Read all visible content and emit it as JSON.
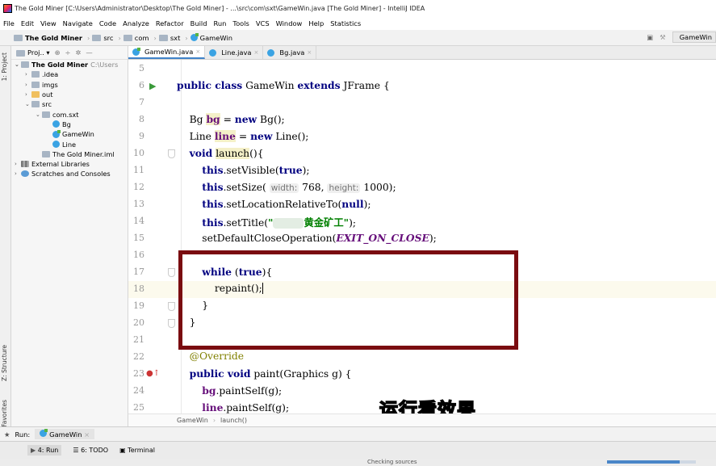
{
  "window": {
    "title": "The Gold Miner [C:\\Users\\Administrator\\Desktop\\The Gold Miner] - ...\\src\\com\\sxt\\GameWin.java [The Gold Miner] - IntelliJ IDEA"
  },
  "menu": [
    "File",
    "Edit",
    "View",
    "Navigate",
    "Code",
    "Analyze",
    "Refactor",
    "Build",
    "Run",
    "Tools",
    "VCS",
    "Window",
    "Help",
    "Statistics"
  ],
  "nav": {
    "crumbs": [
      "The Gold Miner",
      "src",
      "com",
      "sxt",
      "GameWin"
    ],
    "run_config": "GameWin"
  },
  "left_strip": {
    "project": "1: Project",
    "structure": "Z: Structure",
    "favorites": "2: Favorites"
  },
  "project_panel": {
    "header": "Proj..",
    "tree": [
      {
        "label": "The Gold Miner",
        "extra": "C:\\Users",
        "level": 0,
        "arrow": "v",
        "icon": "folder"
      },
      {
        "label": ".idea",
        "level": 1,
        "arrow": ">",
        "icon": "folder"
      },
      {
        "label": "imgs",
        "level": 1,
        "arrow": ">",
        "icon": "folder"
      },
      {
        "label": "out",
        "level": 1,
        "arrow": ">",
        "icon": "out"
      },
      {
        "label": "src",
        "level": 1,
        "arrow": "v",
        "icon": "folder"
      },
      {
        "label": "com.sxt",
        "level": 2,
        "arrow": "v",
        "icon": "folder"
      },
      {
        "label": "Bg",
        "level": 3,
        "arrow": "",
        "icon": "java"
      },
      {
        "label": "GameWin",
        "level": 3,
        "arrow": "",
        "icon": "main"
      },
      {
        "label": "Line",
        "level": 3,
        "arrow": "",
        "icon": "java"
      },
      {
        "label": "The Gold Miner.iml",
        "level": 2,
        "arrow": "",
        "icon": "iml"
      },
      {
        "label": "External Libraries",
        "level": 0,
        "arrow": ">",
        "icon": "lib"
      },
      {
        "label": "Scratches and Consoles",
        "level": 0,
        "arrow": ">",
        "icon": "scratch"
      }
    ]
  },
  "tabs": [
    {
      "label": "GameWin.java",
      "active": true
    },
    {
      "label": "Line.java",
      "active": false
    },
    {
      "label": "Bg.java",
      "active": false
    }
  ],
  "code": {
    "line_numbers": [
      "5",
      "6",
      "7",
      "8",
      "9",
      "10",
      "11",
      "12",
      "13",
      "14",
      "15",
      "16",
      "17",
      "18",
      "19",
      "20",
      "21",
      "22",
      "23",
      "24",
      "25"
    ],
    "hint_width": "width:",
    "hint_height": "height:",
    "title_text": "黄金矿工"
  },
  "caption": "运行看效果",
  "editor_breadcrumb": [
    "GameWin",
    "launch()"
  ],
  "run_bar": {
    "label": "Run:",
    "config": "GameWin"
  },
  "bottom_tabs": [
    "4: Run",
    "6: TODO",
    "Terminal"
  ],
  "status": {
    "text": "Checking sources",
    "progress": 0.82
  }
}
